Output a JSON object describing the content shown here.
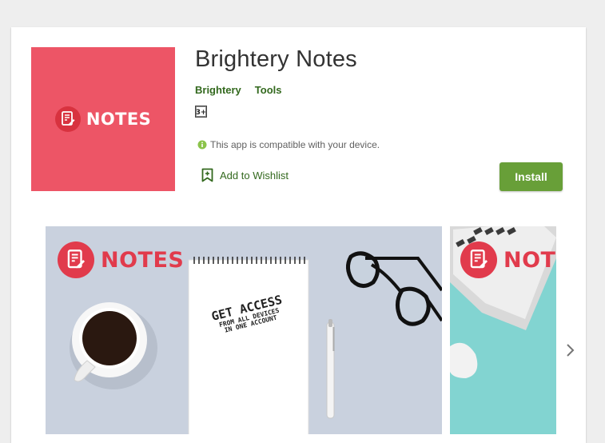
{
  "app": {
    "title": "Brightery Notes",
    "developer": "Brightery",
    "category": "Tools",
    "content_rating": "3+",
    "compatibility": "This app is compatible with your device.",
    "wishlist_label": "Add to Wishlist",
    "install_label": "Install",
    "icon_text": "NOTES"
  },
  "screenshots": [
    {
      "logo_text": "NOTES",
      "headline": "GET ACCESS",
      "subline1": "FROM ALL DEVICES",
      "subline2": "IN ONE ACCOUNT"
    },
    {
      "logo_text": "NOTES"
    }
  ],
  "colors": {
    "page_bg": "#eeeeee",
    "icon_bg": "#ed5566",
    "accent_green": "#689f38",
    "link_green": "#33691e"
  },
  "icons": [
    "notes-logo-icon",
    "content-rating-icon",
    "info-icon",
    "bookmark-icon",
    "chevron-right-icon"
  ]
}
